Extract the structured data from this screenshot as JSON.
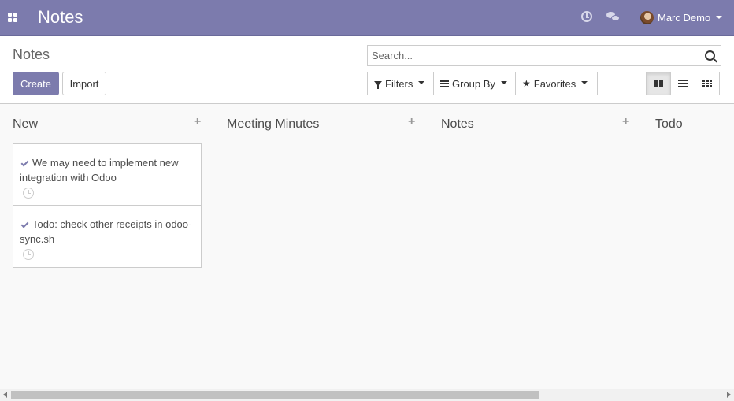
{
  "navbar": {
    "app_title": "Notes",
    "user_name": "Marc Demo",
    "icons": [
      "apps-icon",
      "clock-icon",
      "chat-icon"
    ],
    "color": "#7c7bad"
  },
  "control_panel": {
    "breadcrumb": "Notes",
    "create_label": "Create",
    "import_label": "Import",
    "search_placeholder": "Search...",
    "filters_label": "Filters",
    "group_by_label": "Group By",
    "favorites_label": "Favorites",
    "views": [
      "kanban",
      "list",
      "grid"
    ],
    "active_view": "kanban"
  },
  "kanban": {
    "columns": [
      {
        "title": "New",
        "cards": [
          {
            "text": "We may need to implement new integration with Odoo"
          },
          {
            "text": "Todo: check other receipts in odoo-sync.sh"
          }
        ]
      },
      {
        "title": "Meeting Minutes",
        "cards": []
      },
      {
        "title": "Notes",
        "cards": []
      },
      {
        "title": "Todo",
        "cards": []
      }
    ]
  },
  "colors": {
    "accent": "#7c7bad",
    "background": "#f9f9f9",
    "border": "#cccccc"
  }
}
